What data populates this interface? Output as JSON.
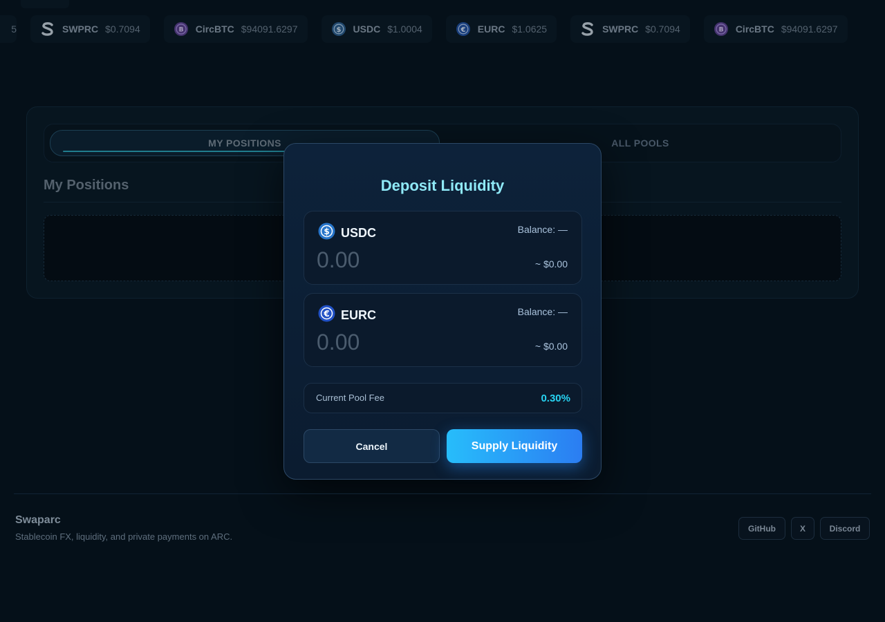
{
  "ticker": [
    {
      "symbol": "SWPRC",
      "price": "$0.7094",
      "icon": "swprc-icon"
    },
    {
      "symbol": "CircBTC",
      "price": "$94091.6297",
      "icon": "circbtc-icon"
    },
    {
      "symbol": "USDC",
      "price": "$1.0004",
      "icon": "usdc-icon"
    },
    {
      "symbol": "EURC",
      "price": "$1.0625",
      "icon": "eurc-icon"
    },
    {
      "symbol": "SWPRC",
      "price": "$0.7094",
      "icon": "swprc-icon"
    },
    {
      "symbol": "CircBTC",
      "price": "$94091.6297",
      "icon": "circbtc-icon"
    }
  ],
  "tabs": {
    "my_positions": "MY POSITIONS",
    "all_pools": "ALL POOLS"
  },
  "section": {
    "title": "My Positions"
  },
  "modal": {
    "title": "Deposit Liquidity",
    "tokens": [
      {
        "name": "USDC",
        "balance": "Balance: —",
        "amount_placeholder": "0.00",
        "usd": "~ $0.00"
      },
      {
        "name": "EURC",
        "balance": "Balance: —",
        "amount_placeholder": "0.00",
        "usd": "~ $0.00"
      }
    ],
    "fee_label": "Current Pool Fee",
    "fee_value": "0.30%",
    "cancel": "Cancel",
    "supply": "Supply Liquidity"
  },
  "footer": {
    "brand": "Swaparc",
    "tagline": "Stablecoin FX, liquidity, and private payments on ARC.",
    "links": [
      "GitHub",
      "X",
      "Discord"
    ]
  },
  "colors": {
    "accent": "#27bdfb",
    "fee": "#27d3f2",
    "title": "#8fe9f7",
    "bg": "#06121c"
  }
}
